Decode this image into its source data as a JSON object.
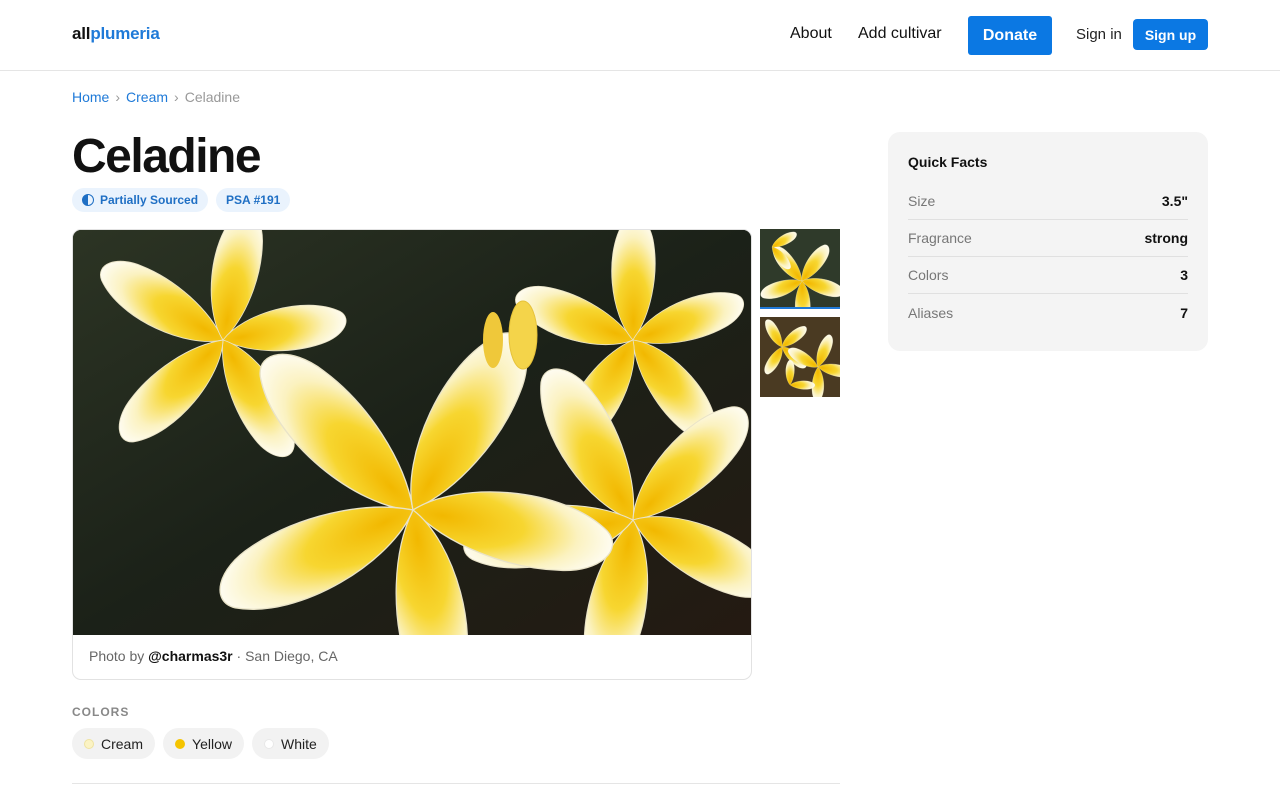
{
  "header": {
    "logo_part1": "all",
    "logo_part2": "plumeria",
    "nav": {
      "about": "About",
      "add_cultivar": "Add cultivar",
      "donate": "Donate",
      "sign_in": "Sign in",
      "sign_up": "Sign up"
    }
  },
  "breadcrumb": {
    "home": "Home",
    "sep1": "›",
    "category": "Cream",
    "sep2": "›",
    "current": "Celadine"
  },
  "title": "Celadine",
  "badges": {
    "sourced": "Partially Sourced",
    "psa": "PSA #191"
  },
  "photo": {
    "caption_prefix": "Photo by",
    "user": "@charmas3r",
    "location": "· San Diego, CA"
  },
  "colors_section": {
    "label": "COLORS",
    "items": [
      {
        "label": "Cream",
        "color": "#fbf3c4"
      },
      {
        "label": "Yellow",
        "color": "#f5c400"
      },
      {
        "label": "White",
        "color": "#ffffff"
      }
    ]
  },
  "quick_facts": {
    "title": "Quick Facts",
    "rows": [
      {
        "key": "Size",
        "value": "3.5\""
      },
      {
        "key": "Fragrance",
        "value": "strong"
      },
      {
        "key": "Colors",
        "value": "3"
      },
      {
        "key": "Aliases",
        "value": "7"
      }
    ]
  },
  "colors": {
    "accent": "#0b78e3",
    "link": "#1f7ad8",
    "badge_bg": "#eaf3fd"
  },
  "icons": {
    "sourced_badge": "half-circle-icon"
  }
}
